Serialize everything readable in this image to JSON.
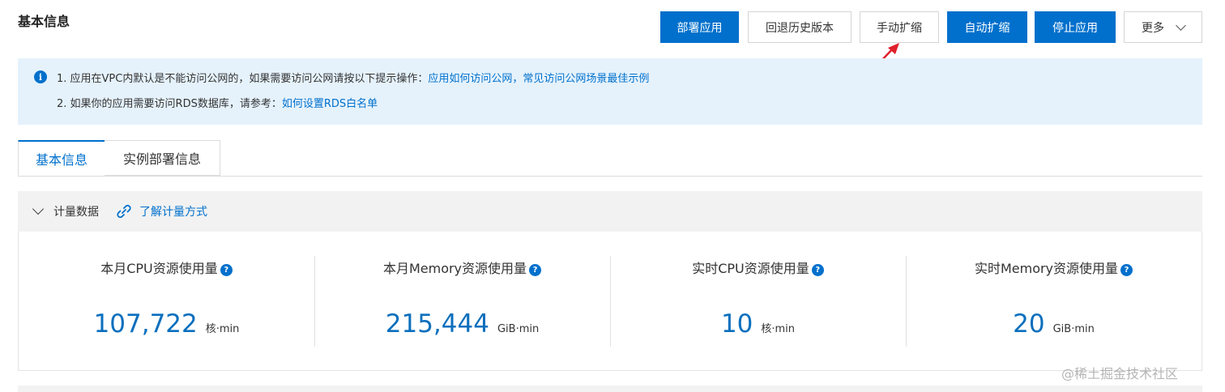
{
  "page": {
    "title": "基本信息"
  },
  "toolbar": {
    "deploy": "部署应用",
    "rollback": "回退历史版本",
    "manual_scale": "手动扩缩",
    "auto_scale": "自动扩缩",
    "stop": "停止应用",
    "more": "更多"
  },
  "notice": {
    "line1_text": "1. 应用在VPC内默认是不能访问公网的，如果需要访问公网请按以下提示操作：",
    "line1_link1": "应用如何访问公网",
    "line1_sep": "，",
    "line1_link2": "常见访问公网场景最佳示例",
    "line2_text": "2. 如果你的应用需要访问RDS数据库，请参考：",
    "line2_link": "如何设置RDS白名单"
  },
  "tabs": [
    {
      "label": "基本信息",
      "active": true
    },
    {
      "label": "实例部署信息",
      "active": false
    }
  ],
  "metering": {
    "title": "计量数据",
    "link": "了解计量方式"
  },
  "metrics": [
    {
      "title": "本月CPU资源使用量",
      "value": "107,722",
      "unit": "核·min"
    },
    {
      "title": "本月Memory资源使用量",
      "value": "215,444",
      "unit": "GiB·min"
    },
    {
      "title": "实时CPU资源使用量",
      "value": "10",
      "unit": "核·min"
    },
    {
      "title": "实时Memory资源使用量",
      "value": "20",
      "unit": "GiB·min"
    }
  ],
  "watermark": "@稀土掘金技术社区",
  "colors": {
    "primary": "#0070cc",
    "notice_bg": "#e5f2fc",
    "arrow": "#e0202a"
  }
}
